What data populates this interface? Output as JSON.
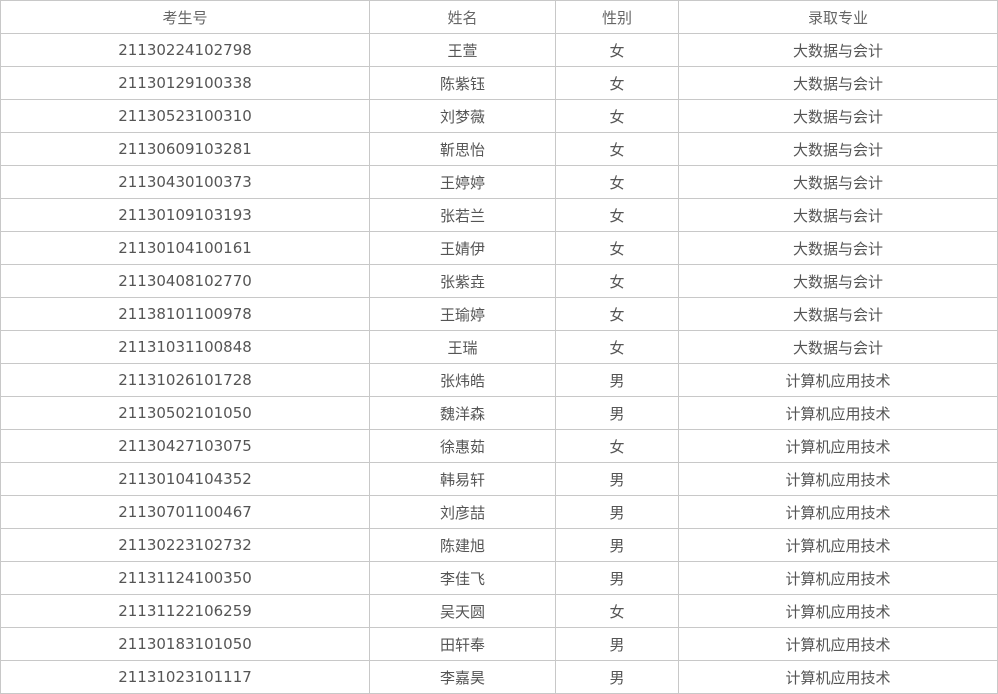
{
  "table": {
    "headers": [
      "考生号",
      "姓名",
      "性别",
      "录取专业"
    ],
    "rows": [
      [
        "21130224102798",
        "王萱",
        "女",
        "大数据与会计"
      ],
      [
        "21130129100338",
        "陈紫钰",
        "女",
        "大数据与会计"
      ],
      [
        "21130523100310",
        "刘梦薇",
        "女",
        "大数据与会计"
      ],
      [
        "21130609103281",
        "靳思怡",
        "女",
        "大数据与会计"
      ],
      [
        "21130430100373",
        "王婷婷",
        "女",
        "大数据与会计"
      ],
      [
        "21130109103193",
        "张若兰",
        "女",
        "大数据与会计"
      ],
      [
        "21130104100161",
        "王婧伊",
        "女",
        "大数据与会计"
      ],
      [
        "21130408102770",
        "张紫垚",
        "女",
        "大数据与会计"
      ],
      [
        "21138101100978",
        "王瑜婷",
        "女",
        "大数据与会计"
      ],
      [
        "21131031100848",
        "王瑞",
        "女",
        "大数据与会计"
      ],
      [
        "21131026101728",
        "张炜皓",
        "男",
        "计算机应用技术"
      ],
      [
        "21130502101050",
        "魏洋森",
        "男",
        "计算机应用技术"
      ],
      [
        "21130427103075",
        "徐惠茹",
        "女",
        "计算机应用技术"
      ],
      [
        "21130104104352",
        "韩易轩",
        "男",
        "计算机应用技术"
      ],
      [
        "21130701100467",
        "刘彦喆",
        "男",
        "计算机应用技术"
      ],
      [
        "21130223102732",
        "陈建旭",
        "男",
        "计算机应用技术"
      ],
      [
        "21131124100350",
        "李佳飞",
        "男",
        "计算机应用技术"
      ],
      [
        "21131122106259",
        "吴天圆",
        "女",
        "计算机应用技术"
      ],
      [
        "21130183101050",
        "田轩奉",
        "男",
        "计算机应用技术"
      ],
      [
        "21131023101117",
        "李嘉昊",
        "男",
        "计算机应用技术"
      ]
    ]
  }
}
